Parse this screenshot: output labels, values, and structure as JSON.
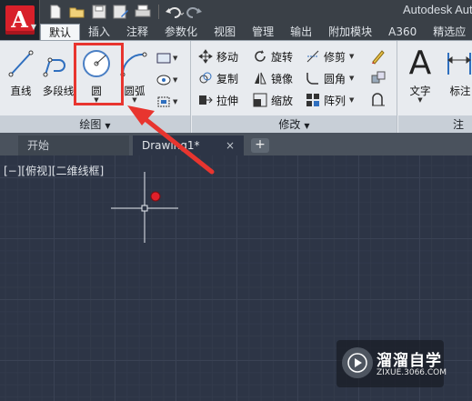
{
  "app": {
    "title": "Autodesk Aut",
    "logo_letter": "A"
  },
  "quick_access": [
    "new-icon",
    "open-icon",
    "save-icon",
    "save-as-icon",
    "print-icon",
    "undo-icon",
    "redo-icon"
  ],
  "ribbon_tabs": [
    "默认",
    "插入",
    "注释",
    "参数化",
    "视图",
    "管理",
    "输出",
    "附加模块",
    "A360",
    "精选应"
  ],
  "active_tab": "默认",
  "draw_group": {
    "title": "绘图",
    "line": "直线",
    "polyline": "多段线",
    "circle": "圆",
    "arc": "圆弧"
  },
  "modify_group": {
    "title": "修改",
    "move": "移动",
    "rotate": "旋转",
    "trim": "修剪",
    "copy": "复制",
    "mirror": "镜像",
    "fillet": "圆角",
    "stretch": "拉伸",
    "scale": "缩放",
    "array": "阵列"
  },
  "annotation_group": {
    "title": "注释",
    "text": "文字",
    "dimension": "标注",
    "text_icon_letter": "A"
  },
  "document_tabs": {
    "home": "开始",
    "drawing": "Drawing1*",
    "close": "×",
    "new": "+"
  },
  "viewport_label": "[−][俯视][二维线框]",
  "watermark": {
    "title": "溜溜自学",
    "url": "ZIXUE.3066.COM"
  },
  "colors": {
    "highlight": "#e8352f",
    "canvas": "#2d3546",
    "ribbon": "#e8ebef",
    "app_red": "#d8202a",
    "cursor_dot": "#e0202a"
  }
}
